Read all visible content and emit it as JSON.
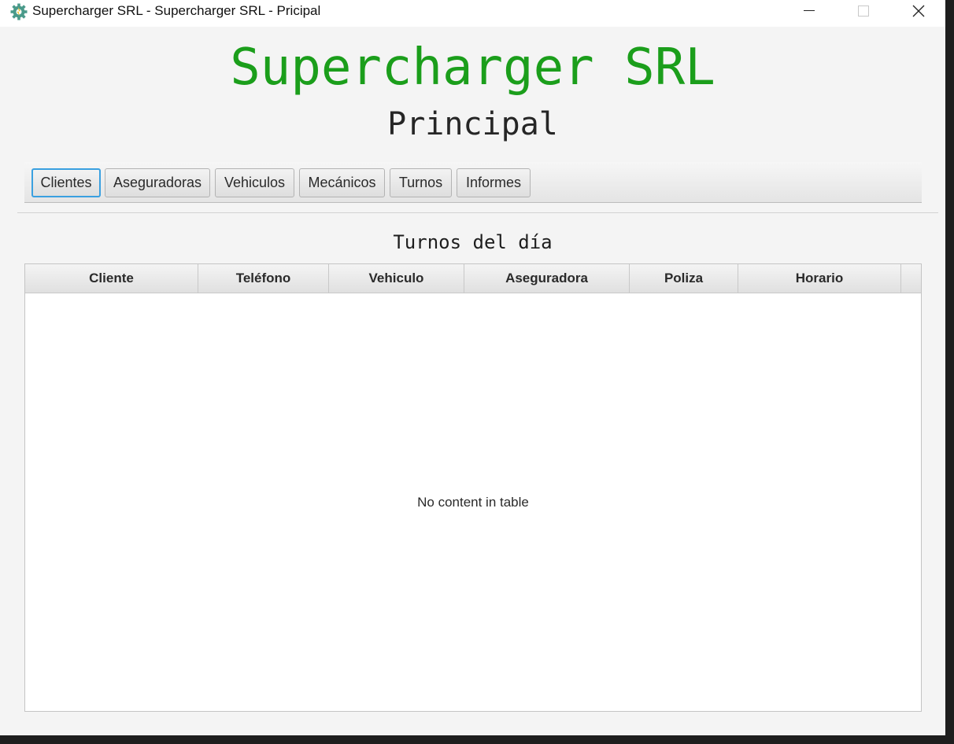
{
  "window": {
    "title": "Supercharger SRL - Supercharger SRL - Pricipal",
    "controls": {
      "minimize_icon": "minimize-icon",
      "maximize_icon": "maximize-icon",
      "close_icon": "close-icon"
    }
  },
  "header": {
    "title": "Supercharger SRL",
    "subtitle": "Principal",
    "title_color": "#1b9e1b"
  },
  "toolbar": {
    "buttons": [
      {
        "label": "Clientes",
        "focused": true
      },
      {
        "label": "Aseguradoras"
      },
      {
        "label": "Vehiculos"
      },
      {
        "label": "Mecánicos"
      },
      {
        "label": "Turnos"
      },
      {
        "label": "Informes"
      }
    ]
  },
  "main": {
    "section_title": "Turnos del día",
    "table": {
      "columns": [
        "Cliente",
        "Teléfono",
        "Vehiculo",
        "Aseguradora",
        "Poliza",
        "Horario"
      ],
      "rows": [],
      "empty_message": "No content in table"
    }
  },
  "colors": {
    "focus_accent": "#3aa0e0"
  }
}
